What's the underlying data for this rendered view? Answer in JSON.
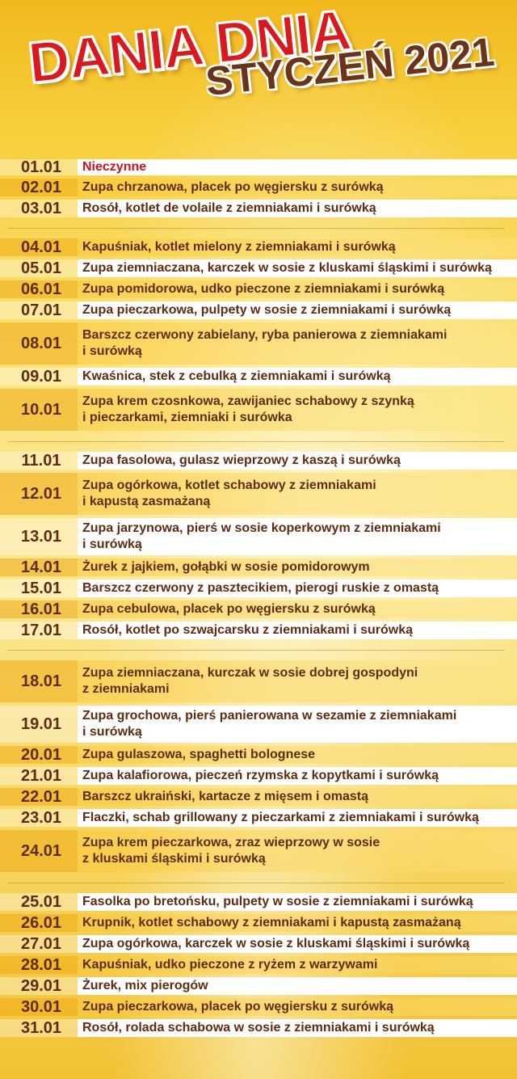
{
  "header": {
    "title": "DANIA DNIA",
    "subtitle": "STYCZEŃ 2021"
  },
  "weeks": [
    [
      {
        "date": "01.01",
        "dish": "Nieczynne",
        "style": "w",
        "h": 24,
        "red": true
      },
      {
        "date": "02.01",
        "dish": "Zupa chrzanowa, placek po węgiersku z surówką",
        "style": "g",
        "h": 26
      },
      {
        "date": "03.01",
        "dish": "Rosół, kotlet de volaile z ziemniakami i surówką",
        "style": "w",
        "h": 26
      }
    ],
    [
      {
        "date": "04.01",
        "dish": "Kapuśniak, kotlet mielony z ziemniakami i surówką",
        "style": "g",
        "h": 26
      },
      {
        "date": "05.01",
        "dish": "Zupa ziemniaczana, karczek w sosie z kluskami śląskimi i surówką",
        "style": "w",
        "h": 26
      },
      {
        "date": "06.01",
        "dish": "Zupa pomidorowa, udko pieczone z ziemniakami i surówką",
        "style": "g",
        "h": 26
      },
      {
        "date": "07.01",
        "dish": "Zupa pieczarkowa, pulpety w sosie z ziemniakami i surówką",
        "style": "w",
        "h": 26
      },
      {
        "date": "08.01",
        "dish": "Barszcz czerwony zabielany, ryba panierowa z ziemniakami\ni surówką",
        "style": "g",
        "h": 56
      },
      {
        "date": "09.01",
        "dish": "Kwaśnica, stek z cebulką z ziemniakami i surówką",
        "style": "w",
        "h": 26
      },
      {
        "date": "10.01",
        "dish": "Zupa krem czosnkowa, zawijaniec schabowy z szynką\ni pieczarkami, ziemniaki i surówka",
        "style": "g",
        "h": 56
      }
    ],
    [
      {
        "date": "11.01",
        "dish": "Zupa fasolowa, gulasz wieprzowy z kaszą i surówką",
        "style": "w",
        "h": 26
      },
      {
        "date": "12.01",
        "dish": "Zupa ogórkowa, kotlet schabowy z ziemniakami\ni kapustą zasmażaną",
        "style": "g",
        "h": 56
      },
      {
        "date": "13.01",
        "dish": "Zupa jarzynowa, pierś w sosie koperkowym z ziemniakami\ni surówką",
        "style": "w",
        "h": 50
      },
      {
        "date": "14.01",
        "dish": "Żurek z jajkiem, gołąbki w sosie pomidorowym",
        "style": "g",
        "h": 26
      },
      {
        "date": "15.01",
        "dish": "Barszcz czerwony z pasztecikiem, pierogi ruskie z omastą",
        "style": "w",
        "h": 26
      },
      {
        "date": "16.01",
        "dish": "Zupa cebulowa, placek po węgiersku z surówką",
        "style": "g",
        "h": 26
      },
      {
        "date": "17.01",
        "dish": "Rosół, kotlet po szwajcarsku z ziemniakami i surówką",
        "style": "w",
        "h": 26
      }
    ],
    [
      {
        "date": "18.01",
        "dish": "Zupa ziemniaczana, kurczak w sosie dobrej gospodyni\nz ziemniakami",
        "style": "g",
        "h": 56
      },
      {
        "date": "19.01",
        "dish": "Zupa grochowa, pierś panierowana w sezamie z ziemniakami\ni surówką",
        "style": "w",
        "h": 50
      },
      {
        "date": "20.01",
        "dish": "Zupa gulaszowa, spaghetti bolognese",
        "style": "g",
        "h": 26
      },
      {
        "date": "21.01",
        "dish": "Zupa kalafiorowa, pieczeń rzymska z kopytkami i surówką",
        "style": "w",
        "h": 26
      },
      {
        "date": "22.01",
        "dish": "Barszcz ukraiński, kartacze z mięsem i omastą",
        "style": "g",
        "h": 26
      },
      {
        "date": "23.01",
        "dish": "Flaczki, schab grillowany z pieczarkami z ziemniakami i surówką",
        "style": "w",
        "h": 26
      },
      {
        "date": "24.01",
        "dish": "Zupa krem pieczarkowa, zraz wieprzowy w sosie\nz kluskami śląskimi i surówką",
        "style": "g",
        "h": 56
      }
    ],
    [
      {
        "date": "25.01",
        "dish": "Fasolka po bretońsku, pulpety w sosie z ziemniakami i surówką",
        "style": "w",
        "h": 26
      },
      {
        "date": "26.01",
        "dish": "Krupnik, kotlet schabowy z ziemniakami i kapustą zasmażaną",
        "style": "g",
        "h": 26
      },
      {
        "date": "27.01",
        "dish": "Zupa ogórkowa, karczek w sosie z kluskami śląskimi i surówką",
        "style": "w",
        "h": 26
      },
      {
        "date": "28.01",
        "dish": "Kapuśniak, udko pieczone z ryżem z warzywami",
        "style": "g",
        "h": 26
      },
      {
        "date": "29.01",
        "dish": "Żurek, mix pierogów",
        "style": "w",
        "h": 26
      },
      {
        "date": "30.01",
        "dish": "Zupa pieczarkowa, placek po węgiersku z surówką",
        "style": "g",
        "h": 26
      },
      {
        "date": "31.01",
        "dish": "Rosół, rolada schabowa w sosie z ziemniakami i surówką",
        "style": "w",
        "h": 26
      }
    ]
  ]
}
